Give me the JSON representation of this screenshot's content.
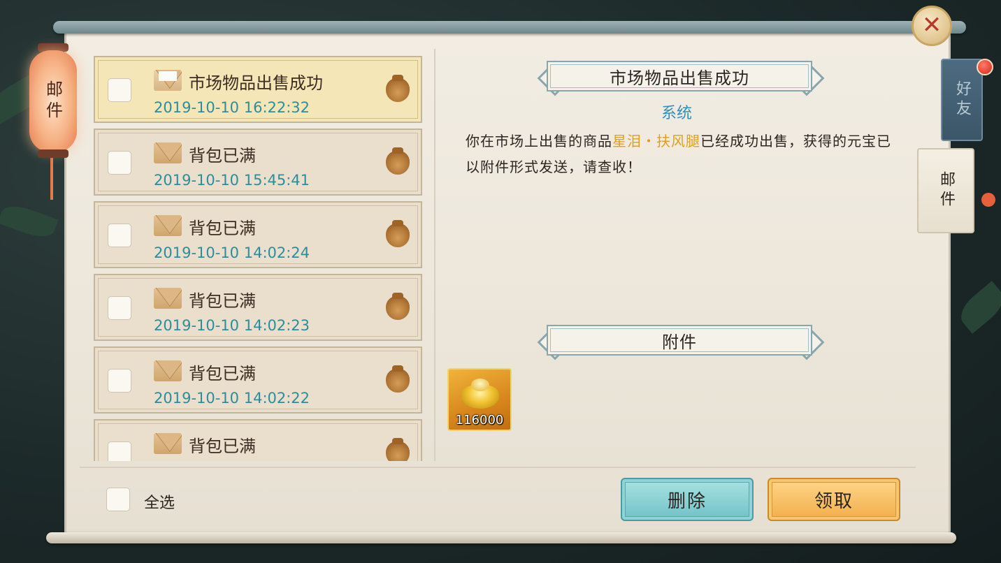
{
  "side_nav": {
    "lantern_label": "邮件"
  },
  "close_button": {
    "icon": "close-icon",
    "glyph": "✕"
  },
  "right_tabs": [
    {
      "label": "好友",
      "active": false,
      "has_notification": true
    },
    {
      "label": "邮件",
      "active": true
    }
  ],
  "mail_list": [
    {
      "title": "市场物品出售成功",
      "time": "2019-10-10  16:22:32",
      "selected": true,
      "opened": true
    },
    {
      "title": "背包已满",
      "time": "2019-10-10  15:45:41",
      "selected": false,
      "opened": false
    },
    {
      "title": "背包已满",
      "time": "2019-10-10  14:02:24",
      "selected": false,
      "opened": false
    },
    {
      "title": "背包已满",
      "time": "2019-10-10  14:02:23",
      "selected": false,
      "opened": false
    },
    {
      "title": "背包已满",
      "time": "2019-10-10  14:02:22",
      "selected": false,
      "opened": false
    },
    {
      "title": "背包已满",
      "time": "",
      "selected": false,
      "opened": false
    }
  ],
  "detail": {
    "title": "市场物品出售成功",
    "sender": "系统",
    "body_prefix": "你在市场上出售的商品",
    "item_name": "星泪・扶风腿",
    "body_suffix": "已经成功出售，获得的元宝已以附件形式发送，请查收！",
    "attachments_title": "附件",
    "attachment": {
      "icon": "gold-ingot-icon",
      "count": "116000"
    }
  },
  "footer": {
    "select_all_label": "全选",
    "delete_label": "删除",
    "claim_label": "领取"
  },
  "colors": {
    "timestamp": "#2e8c9b",
    "sender": "#2e8fbf",
    "highlight": "#e0a01e",
    "delete_button": "#70c1c6",
    "claim_button": "#f2ae48"
  }
}
